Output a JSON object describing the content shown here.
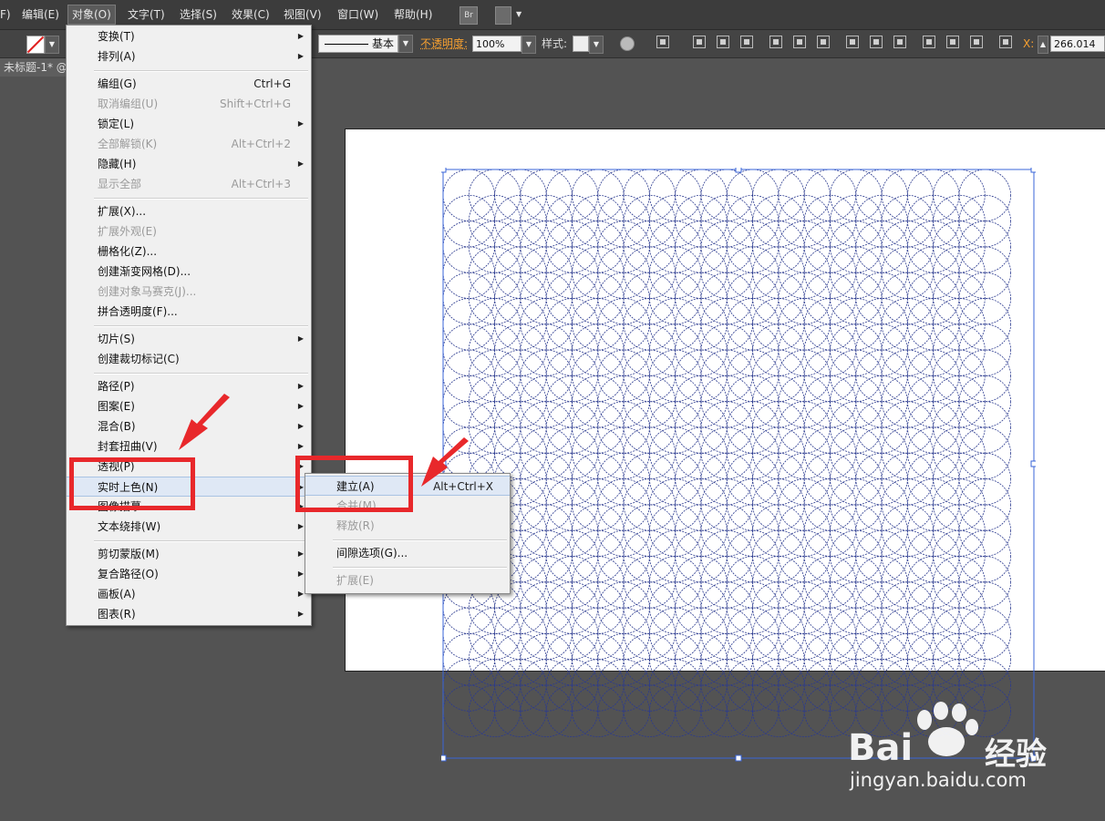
{
  "menubar": {
    "items": [
      "F)",
      "编辑(E)",
      "对象(O)",
      "文字(T)",
      "选择(S)",
      "效果(C)",
      "视图(V)",
      "窗口(W)",
      "帮助(H)"
    ],
    "active": "对象(O)",
    "bridge_icon": "Br",
    "workspace_icon": "workspace-switcher-icon"
  },
  "controlbar": {
    "stroke_label": "基本",
    "opacity_label": "不透明度:",
    "opacity_value": "100%",
    "style_label": "样式:",
    "x_label": "X:",
    "x_value": "266.014"
  },
  "tab": {
    "title": "未标题-1* @"
  },
  "object_menu": {
    "items": [
      {
        "label": "变换(T)",
        "shortcut": "",
        "submenu": true,
        "disabled": false
      },
      {
        "label": "排列(A)",
        "shortcut": "",
        "submenu": true,
        "disabled": false
      },
      {
        "label": "编组(G)",
        "shortcut": "Ctrl+G",
        "submenu": false,
        "disabled": false
      },
      {
        "label": "取消编组(U)",
        "shortcut": "Shift+Ctrl+G",
        "submenu": false,
        "disabled": true
      },
      {
        "label": "锁定(L)",
        "shortcut": "",
        "submenu": true,
        "disabled": false
      },
      {
        "label": "全部解锁(K)",
        "shortcut": "Alt+Ctrl+2",
        "submenu": false,
        "disabled": true
      },
      {
        "label": "隐藏(H)",
        "shortcut": "",
        "submenu": true,
        "disabled": false
      },
      {
        "label": "显示全部",
        "shortcut": "Alt+Ctrl+3",
        "submenu": false,
        "disabled": true
      },
      {
        "label": "扩展(X)...",
        "shortcut": "",
        "submenu": false,
        "disabled": false
      },
      {
        "label": "扩展外观(E)",
        "shortcut": "",
        "submenu": false,
        "disabled": true
      },
      {
        "label": "栅格化(Z)...",
        "shortcut": "",
        "submenu": false,
        "disabled": false
      },
      {
        "label": "创建渐变网格(D)...",
        "shortcut": "",
        "submenu": false,
        "disabled": false
      },
      {
        "label": "创建对象马赛克(J)...",
        "shortcut": "",
        "submenu": false,
        "disabled": true
      },
      {
        "label": "拼合透明度(F)...",
        "shortcut": "",
        "submenu": false,
        "disabled": false
      },
      {
        "label": "切片(S)",
        "shortcut": "",
        "submenu": true,
        "disabled": false
      },
      {
        "label": "创建裁切标记(C)",
        "shortcut": "",
        "submenu": false,
        "disabled": false
      },
      {
        "label": "路径(P)",
        "shortcut": "",
        "submenu": true,
        "disabled": false
      },
      {
        "label": "图案(E)",
        "shortcut": "",
        "submenu": true,
        "disabled": false
      },
      {
        "label": "混合(B)",
        "shortcut": "",
        "submenu": true,
        "disabled": false
      },
      {
        "label": "封套扭曲(V)",
        "shortcut": "",
        "submenu": true,
        "disabled": false
      },
      {
        "label": "透视(P)",
        "shortcut": "",
        "submenu": true,
        "disabled": false
      },
      {
        "label": "实时上色(N)",
        "shortcut": "",
        "submenu": true,
        "disabled": false
      },
      {
        "label": "图像描摹",
        "shortcut": "",
        "submenu": true,
        "disabled": false
      },
      {
        "label": "文本绕排(W)",
        "shortcut": "",
        "submenu": true,
        "disabled": false
      },
      {
        "label": "剪切蒙版(M)",
        "shortcut": "",
        "submenu": true,
        "disabled": false
      },
      {
        "label": "复合路径(O)",
        "shortcut": "",
        "submenu": true,
        "disabled": false
      },
      {
        "label": "画板(A)",
        "shortcut": "",
        "submenu": true,
        "disabled": false
      },
      {
        "label": "图表(R)",
        "shortcut": "",
        "submenu": true,
        "disabled": false
      }
    ]
  },
  "live_paint_submenu": {
    "items": [
      {
        "label": "建立(A)",
        "shortcut": "Alt+Ctrl+X",
        "disabled": false
      },
      {
        "label": "合并(M)",
        "shortcut": "",
        "disabled": true
      },
      {
        "label": "释放(R)",
        "shortcut": "",
        "disabled": true
      },
      {
        "label": "间隙选项(G)...",
        "shortcut": "",
        "disabled": false
      },
      {
        "label": "扩展(E)",
        "shortcut": "",
        "disabled": true
      }
    ]
  },
  "watermark": {
    "brand": "Bai",
    "brand_cn": "经验",
    "url": "jingyan.baidu.com"
  },
  "colors": {
    "selection": "#3a64d8",
    "annotation": "#e8282b",
    "canvas": "#535353"
  }
}
